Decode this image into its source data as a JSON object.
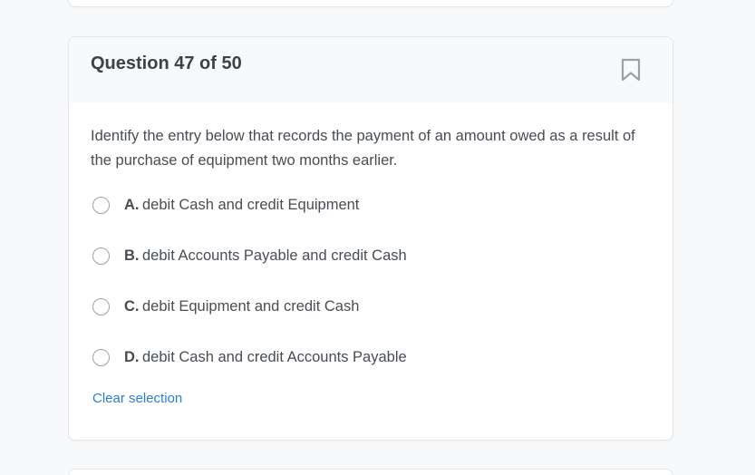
{
  "question": {
    "title": "Question 47 of 50",
    "text": "Identify the entry below that records the payment of an amount owed as a result of the purchase of equipment two months earlier.",
    "bookmark_icon": "bookmark-outline-icon"
  },
  "options": [
    {
      "letter": "A.",
      "text": "debit Cash and credit Equipment",
      "selected": false
    },
    {
      "letter": "B.",
      "text": "debit Accounts Payable and credit Cash",
      "selected": false
    },
    {
      "letter": "C.",
      "text": "debit Equipment and credit Cash",
      "selected": false
    },
    {
      "letter": "D.",
      "text": "debit Cash and credit Accounts Payable",
      "selected": false
    }
  ],
  "clear_label": "Clear selection",
  "colors": {
    "link": "#2a7fd4",
    "title": "#3d4248",
    "body_text": "#474d54",
    "header_bg": "#f8f9fa",
    "radio_border": "#9aa1a8",
    "bookmark": "#9aa1a8"
  }
}
